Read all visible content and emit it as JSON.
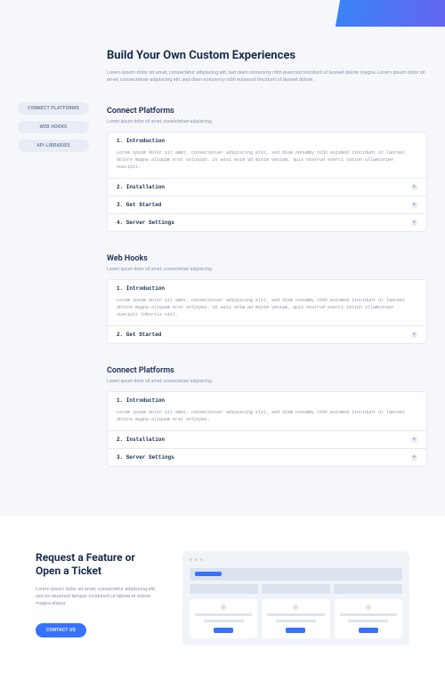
{
  "hero": {
    "title": "Build Your Own Custom Experiences",
    "lead": "Lorem ipsum dolor sit amet, consectetur adipiscing elit, sed diam nonummy nibh euismod tincidunt ut laoreet dolore magna. Lorem ipsum dolor sit amet, consectetuer adipiscing elit, sed diam nonummy nibh euismod tincidunt ut laoreet dolore."
  },
  "sidebar": {
    "items": [
      {
        "label": "CONNECT PLATFORMS"
      },
      {
        "label": "WEB HOOKS"
      },
      {
        "label": "API LIBRARIES"
      }
    ]
  },
  "sections": [
    {
      "title": "Connect Platforms",
      "sub": "Lorem ipsum dolor sit amet, consectetuer adipisicing.",
      "items": [
        {
          "num": "1.",
          "label": "Introduction",
          "expanded": true,
          "body": "Lorem ipsum dolor sit amet, consectetuer adipiscing elit, sed diam nonummy nibh euismod tincidunt ut laoreet dolore magna aliquam erat volutpat. Ut wisi enim ad minim veniam, quis nostrud exerci tation ullamcorper suscipit."
        },
        {
          "num": "2.",
          "label": "Installation",
          "expanded": false
        },
        {
          "num": "3.",
          "label": "Get Started",
          "expanded": false
        },
        {
          "num": "4.",
          "label": "Server Settings",
          "expanded": false
        }
      ]
    },
    {
      "title": "Web Hooks",
      "sub": "Lorem ipsum dolor sit amet, consectetuer adipisicing.",
      "items": [
        {
          "num": "1.",
          "label": "Introduction",
          "expanded": true,
          "body": "Lorem ipsum dolor sit amet, consectetuer adipiscing elit, sed diam nonummy nibh euismod tincidunt ut laoreet dolore magna aliquam erat volutpat. Ut wisi enim ad minim veniam, quis nostrud exerci tation ullamcorper suscipit lobortis nisl."
        },
        {
          "num": "2.",
          "label": "Get Started",
          "expanded": false
        }
      ]
    },
    {
      "title": "Connect Platforms",
      "sub": "Lorem ipsum dolor sit amet, consectetuer adipisicing.",
      "items": [
        {
          "num": "1.",
          "label": "Introduction",
          "expanded": true,
          "body": "Lorem ipsum dolor sit amet, consectetuer adipiscing elit, sed diam nonummy nibh euismod tincidunt ut laoreet dolore magna aliquam erat volutpat."
        },
        {
          "num": "2.",
          "label": "Installation",
          "expanded": false
        },
        {
          "num": "3.",
          "label": "Server Settings",
          "expanded": false
        }
      ]
    }
  ],
  "cta": {
    "title": "Request a Feature or Open a Ticket",
    "body": "Lorem ipsum dolor sit amet, consectetur adipiscing elit, sed do eiusmod tempor incididunt ut labore et dolore magna aliqua.",
    "button": "CONTACT US"
  }
}
